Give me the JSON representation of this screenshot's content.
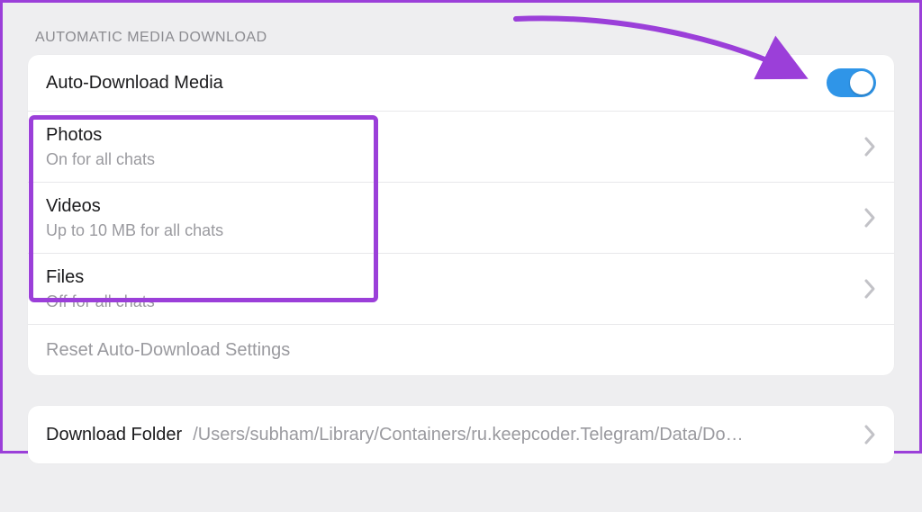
{
  "section_label": "AUTOMATIC MEDIA DOWNLOAD",
  "master_toggle": {
    "label": "Auto-Download Media",
    "on": true
  },
  "items": [
    {
      "title": "Photos",
      "subtitle": "On for all chats"
    },
    {
      "title": "Videos",
      "subtitle": "Up to 10 MB for all chats"
    },
    {
      "title": "Files",
      "subtitle": "Off for all chats"
    }
  ],
  "reset_label": "Reset Auto-Download Settings",
  "download_folder": {
    "label": "Download Folder",
    "path": "/Users/subham/Library/Containers/ru.keepcoder.Telegram/Data/Do…"
  },
  "colors": {
    "accent": "#2f95e8",
    "annotation": "#9b3fd9"
  }
}
